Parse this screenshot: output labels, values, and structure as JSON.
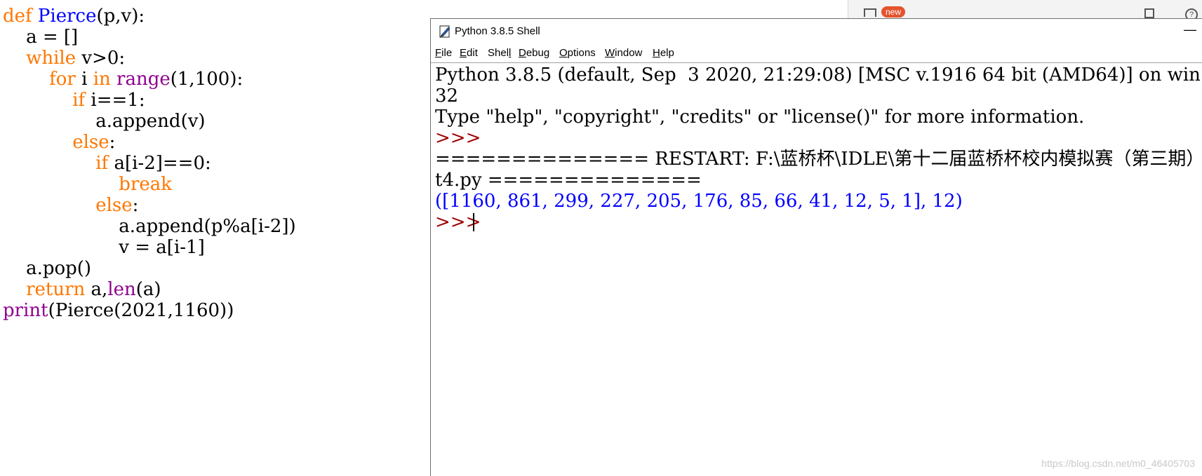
{
  "editor": {
    "lines": [
      {
        "indent": "",
        "tokens": [
          {
            "t": "def",
            "c": "kw"
          },
          {
            "t": " ",
            "c": "plain"
          },
          {
            "t": "Pierce",
            "c": "def"
          },
          {
            "t": "(p,v):",
            "c": "plain"
          }
        ]
      },
      {
        "indent": "    ",
        "tokens": [
          {
            "t": "a = []",
            "c": "plain"
          }
        ]
      },
      {
        "indent": "    ",
        "tokens": [
          {
            "t": "while",
            "c": "kw"
          },
          {
            "t": " v>0:",
            "c": "plain"
          }
        ]
      },
      {
        "indent": "        ",
        "tokens": [
          {
            "t": "for",
            "c": "kw"
          },
          {
            "t": " i ",
            "c": "plain"
          },
          {
            "t": "in",
            "c": "kw"
          },
          {
            "t": " ",
            "c": "plain"
          },
          {
            "t": "range",
            "c": "builtin"
          },
          {
            "t": "(1,100):",
            "c": "plain"
          }
        ]
      },
      {
        "indent": "            ",
        "tokens": [
          {
            "t": "if",
            "c": "kw"
          },
          {
            "t": " i==1:",
            "c": "plain"
          }
        ]
      },
      {
        "indent": "                ",
        "tokens": [
          {
            "t": "a.append(v)",
            "c": "plain"
          }
        ]
      },
      {
        "indent": "            ",
        "tokens": [
          {
            "t": "else",
            "c": "kw"
          },
          {
            "t": ":",
            "c": "plain"
          }
        ]
      },
      {
        "indent": "                ",
        "tokens": [
          {
            "t": "if",
            "c": "kw"
          },
          {
            "t": " a[i-2]==0:",
            "c": "plain"
          }
        ]
      },
      {
        "indent": "                    ",
        "tokens": [
          {
            "t": "break",
            "c": "kw"
          }
        ]
      },
      {
        "indent": "                ",
        "tokens": [
          {
            "t": "else",
            "c": "kw"
          },
          {
            "t": ":",
            "c": "plain"
          }
        ]
      },
      {
        "indent": "                    ",
        "tokens": [
          {
            "t": "a.append(p%a[i-2])",
            "c": "plain"
          }
        ]
      },
      {
        "indent": "                    ",
        "tokens": [
          {
            "t": "v = a[i-1]",
            "c": "plain"
          }
        ]
      },
      {
        "indent": "    ",
        "tokens": [
          {
            "t": "a.pop()",
            "c": "plain"
          }
        ]
      },
      {
        "indent": "    ",
        "tokens": [
          {
            "t": "return",
            "c": "kw"
          },
          {
            "t": " a,",
            "c": "plain"
          },
          {
            "t": "len",
            "c": "builtin"
          },
          {
            "t": "(a)",
            "c": "plain"
          }
        ]
      },
      {
        "indent": "",
        "tokens": [
          {
            "t": "print",
            "c": "builtin"
          },
          {
            "t": "(Pierce(2021,1160))",
            "c": "plain"
          }
        ]
      }
    ]
  },
  "background_window": {
    "badge": "new",
    "help_glyph": "?"
  },
  "shell": {
    "title": "Python 3.8.5 Shell",
    "icon": "idle-feather-icon",
    "minimize_glyph": "—",
    "menu": [
      {
        "label": "File",
        "mnemonic_index": 0
      },
      {
        "label": "Edit",
        "mnemonic_index": 0
      },
      {
        "label": "Shell",
        "mnemonic_index": 4
      },
      {
        "label": "Debug",
        "mnemonic_index": 0
      },
      {
        "label": "Options",
        "mnemonic_index": 0
      },
      {
        "label": "Window",
        "mnemonic_index": 0
      },
      {
        "label": "Help",
        "mnemonic_index": 0
      }
    ],
    "output": [
      {
        "text": "Python 3.8.5 (default, Sep  3 2020, 21:29:08) [MSC v.1916 64 bit (AMD64)] on win",
        "kind": "plain"
      },
      {
        "text": "32",
        "kind": "plain"
      },
      {
        "text": "Type \"help\", \"copyright\", \"credits\" or \"license()\" for more information.",
        "kind": "plain"
      },
      {
        "text": ">>>",
        "kind": "prompt"
      },
      {
        "text": "============== RESTART: F:\\蓝桥杯\\IDLE\\第十二届蓝桥杯校内模拟赛（第三期）\\",
        "kind": "plain"
      },
      {
        "text": "t4.py ==============",
        "kind": "plain"
      },
      {
        "text": "([1160, 861, 299, 227, 205, 176, 85, 66, 41, 12, 5, 1], 12)",
        "kind": "result"
      },
      {
        "text": ">>> ",
        "kind": "prompt"
      }
    ]
  },
  "watermark": "https://blog.csdn.net/m0_46405703",
  "colors": {
    "keyword": "#ff7700",
    "definition": "#0000ff",
    "builtin": "#900090",
    "prompt": "#a00000",
    "result": "#0000ff"
  }
}
